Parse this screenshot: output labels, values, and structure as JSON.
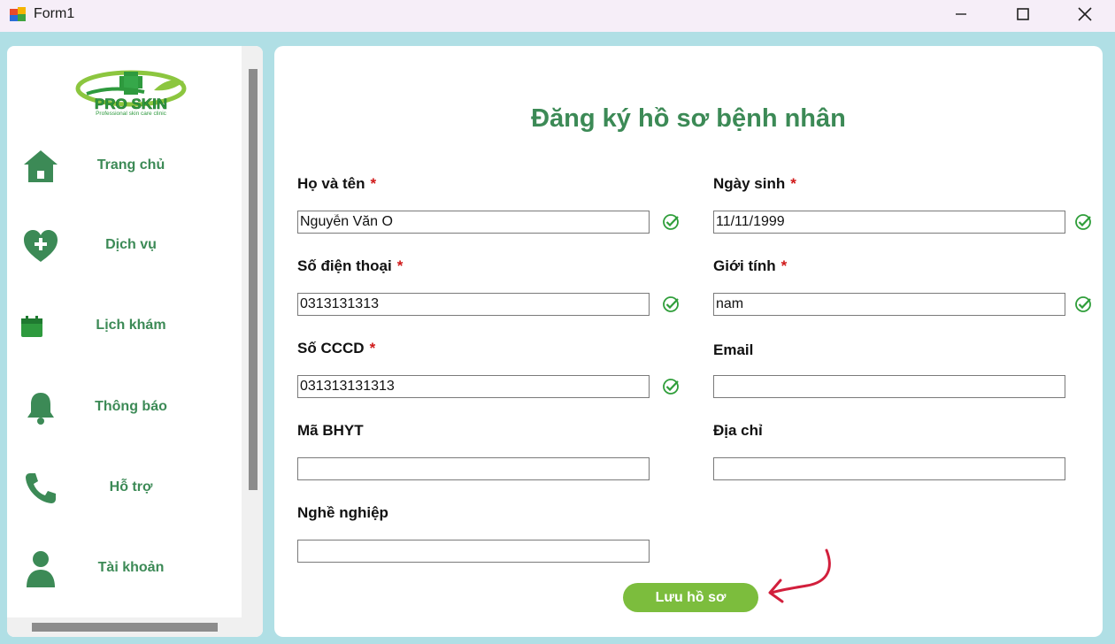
{
  "window": {
    "title": "Form1"
  },
  "sidebar": {
    "logo": {
      "brand": "PRO SKIN",
      "tagline": "Professional skin care clinic"
    },
    "items": [
      {
        "label": "Trang chủ",
        "icon": "home-icon"
      },
      {
        "label": "Dịch vụ",
        "icon": "heart-plus-icon"
      },
      {
        "label": "Lịch khám",
        "icon": "calendar-icon"
      },
      {
        "label": "Thông báo",
        "icon": "bell-icon"
      },
      {
        "label": "Hỗ trợ",
        "icon": "phone-icon"
      },
      {
        "label": "Tài khoản",
        "icon": "user-icon"
      }
    ]
  },
  "form": {
    "title": "Đăng ký hồ sơ bệnh nhân",
    "fields": {
      "ho_ten": {
        "label": "Họ và tên",
        "required": "*",
        "value": "Nguyễn Văn O",
        "valid": true
      },
      "ngay_sinh": {
        "label": "Ngày sinh",
        "required": "*",
        "value": "11/11/1999",
        "valid": true
      },
      "so_dien_thoai": {
        "label": "Số điện thoại",
        "required": "*",
        "value": "0313131313",
        "valid": true
      },
      "gioi_tinh": {
        "label": "Giới tính",
        "required": "*",
        "value": "nam",
        "valid": true
      },
      "so_cccd": {
        "label": "Số CCCD",
        "required": "*",
        "value": "031313131313",
        "valid": true
      },
      "email": {
        "label": "Email",
        "value": ""
      },
      "ma_bhyt": {
        "label": "Mã BHYT",
        "value": ""
      },
      "dia_chi": {
        "label": "Địa chỉ",
        "value": ""
      },
      "nghe_nghiep": {
        "label": "Nghề nghiệp",
        "value": ""
      }
    },
    "save_label": "Lưu hồ sơ"
  },
  "colors": {
    "background": "#b0dfe5",
    "accent_green": "#3c8a56",
    "button_green": "#7cbd3d",
    "required_red": "#d01818",
    "check_green": "#2f9e3a",
    "annotation_red": "#d21f3c"
  }
}
